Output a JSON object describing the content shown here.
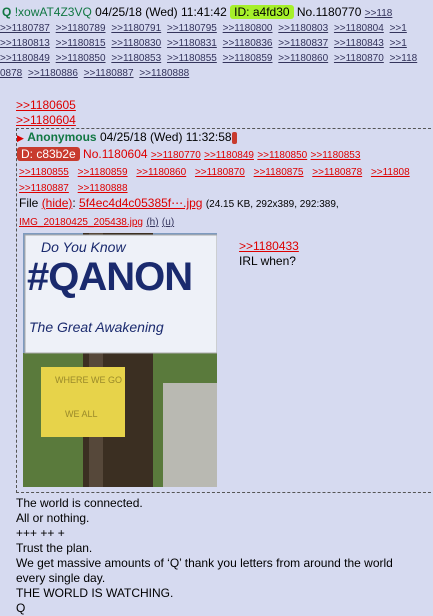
{
  "header": {
    "q": "Q",
    "tripcode": "!xowAT4Z3VQ",
    "datetime": "04/25/18 (Wed) 11:41:42",
    "id_badge": "ID: a4fd30",
    "post_no": "No.1180770",
    "post_link": ">>118"
  },
  "top_replies": [
    ">>1180787",
    ">>1180789",
    ">>1180791",
    ">>1180795",
    ">>1180800",
    ">>1180803",
    ">>1180804",
    ">>1",
    ">>1180813",
    ">>1180815",
    ">>1180830",
    ">>1180831",
    ">>1180836",
    ">>1180837",
    ">>1180843",
    ">>1",
    ">>1180849",
    ">>1180850",
    ">>1180853",
    ">>1180855",
    ">>1180859",
    ">>1180860",
    ">>1180870",
    ">>118",
    "0878",
    ">>1180886",
    ">>1180887",
    ">>1180888"
  ],
  "quote_links": [
    ">>1180605",
    ">>1180604"
  ],
  "inner": {
    "name": "Anonymous",
    "datetime": "04/25/18 (Wed) 11:32:58",
    "id_badge": "D: c83b2e",
    "post_no": "No.1180604",
    "replies": [
      ">>1180770",
      ">>1180849",
      ">>1180850",
      ">>1180853",
      ">>1180855",
      ">>1180859",
      ">>1180860",
      ">>1180870",
      ">>1180875",
      ">>1180878",
      ">>11808",
      ">>1180887",
      ">>1180888"
    ],
    "file_label": "File",
    "hide": "(hide)",
    "filename": "5f4ec4d4c05385f⋯.jpg",
    "file_meta": "(24.15 KB, 292x389, 292:389,",
    "orig_name": "IMG_20180425_205438.jpg",
    "h": "(h)",
    "u": "(u)",
    "sign_line1": "Do You Know",
    "sign_line2": "#QANON",
    "sign_line3": "The Great Awakening",
    "sign_line4": "WHERE WE GO",
    "sign_line5": "WE ALL",
    "reply_quote": ">>1180433",
    "reply_text": "IRL when?"
  },
  "body_lines": [
    "The world is connected.",
    "All or nothing.",
    "+++ ++ +",
    "Trust the plan.",
    "We get massive amounts of ‘Q’ thank you letters from around the world",
    "every single day.",
    "THE WORLD IS WATCHING.",
    "Q"
  ]
}
